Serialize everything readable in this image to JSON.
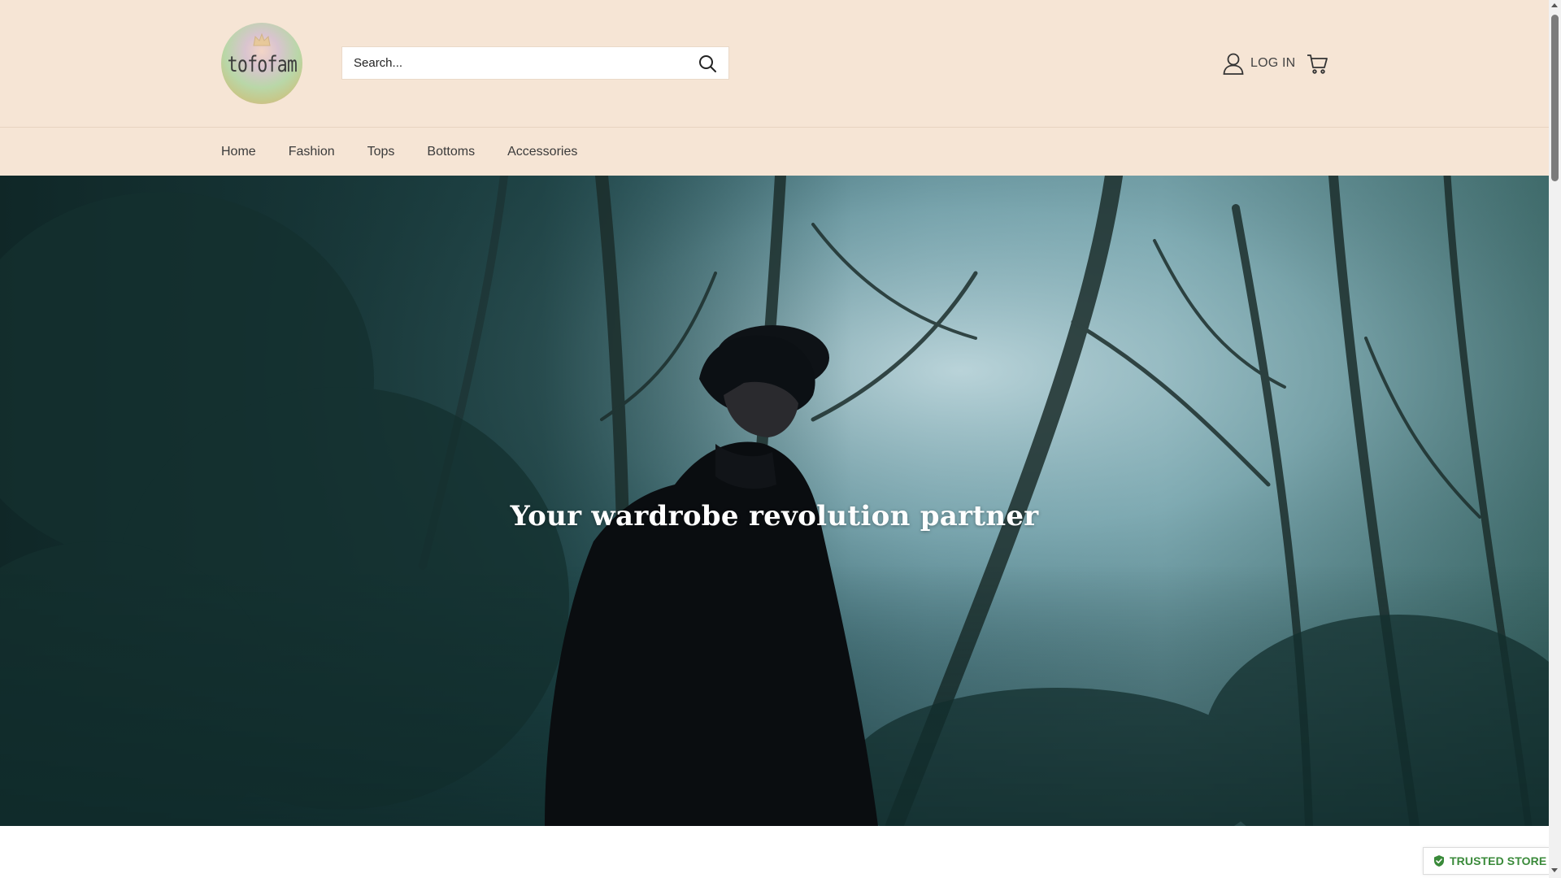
{
  "header": {
    "logo_text": "tofofam",
    "search": {
      "placeholder": "Search..."
    },
    "account_label": "LOG IN"
  },
  "nav": {
    "items": [
      {
        "label": "Home"
      },
      {
        "label": "Fashion"
      },
      {
        "label": "Tops"
      },
      {
        "label": "Bottoms"
      },
      {
        "label": "Accessories"
      }
    ]
  },
  "hero": {
    "title": "Your wardrobe revolution partner"
  },
  "badges": {
    "trusted_label": "TRUSTED STORE"
  },
  "colors": {
    "header_bg": "#f6e5d5",
    "trusted_green": "#3a8a3a"
  },
  "icons": {
    "search": "search-icon",
    "account": "user-icon",
    "cart": "cart-icon",
    "trusted": "shield-check-icon"
  }
}
